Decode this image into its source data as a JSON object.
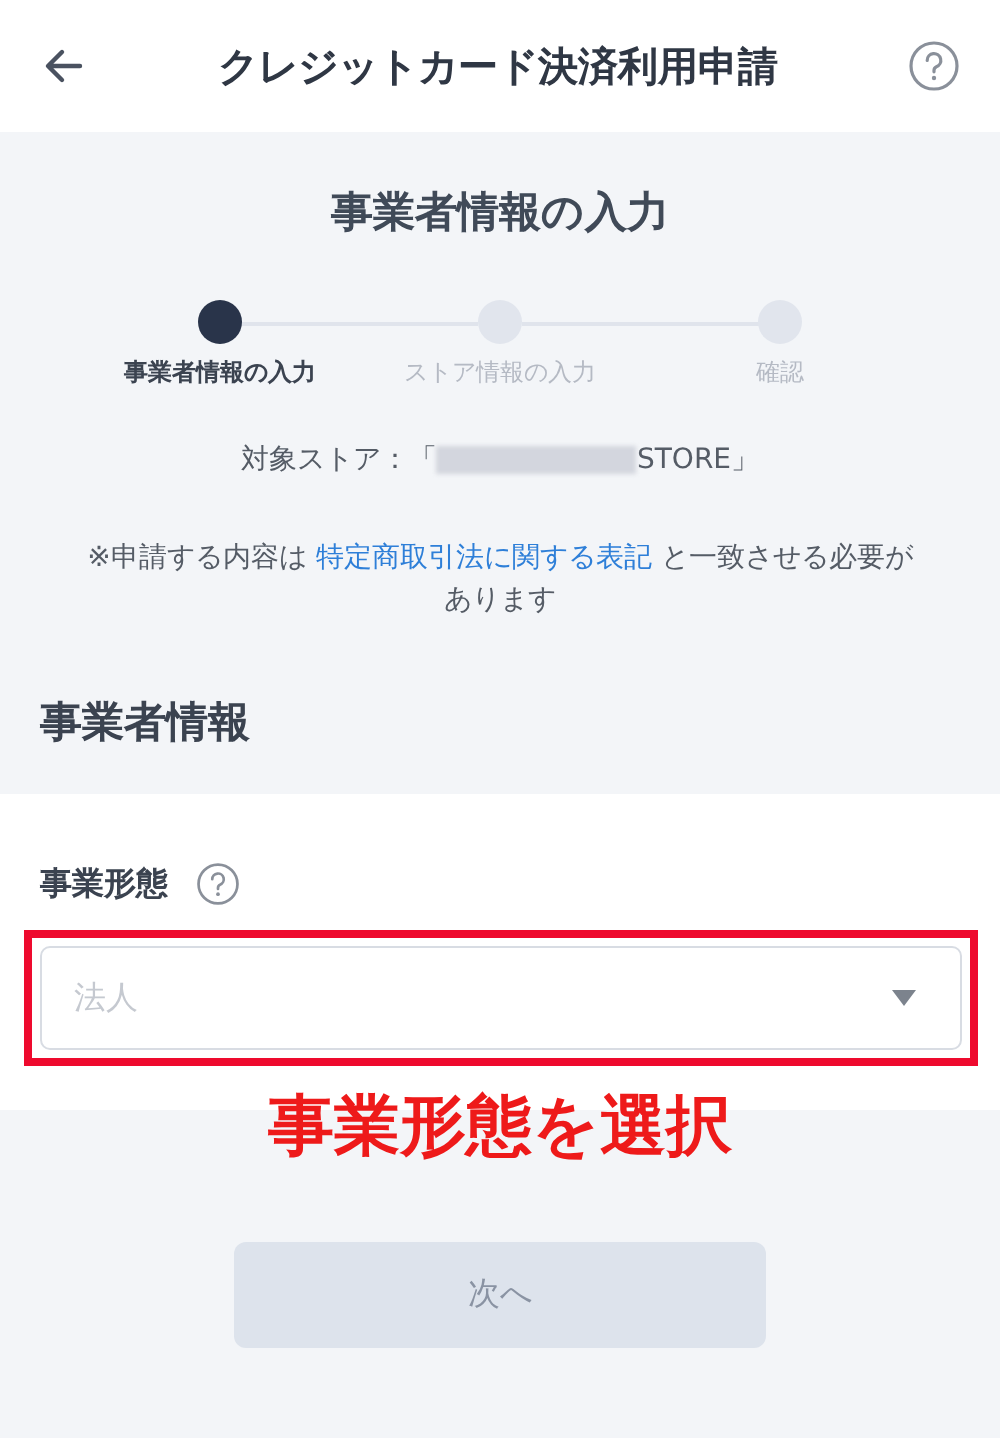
{
  "header": {
    "title": "クレジットカード決済利用申請"
  },
  "form_heading": "事業者情報の入力",
  "steps": [
    {
      "label": "事業者情報の入力",
      "selected": true
    },
    {
      "label": "ストア情報の入力",
      "selected": false
    },
    {
      "label": "確認",
      "selected": false
    }
  ],
  "store": {
    "prefix": "対象ストア：「",
    "suffix": "STORE」"
  },
  "notice": {
    "before": "※申請する内容は ",
    "link": "特定商取引法に関する表記",
    "after": " と一致させる必要があります"
  },
  "section_title": "事業者情報",
  "business_type": {
    "label": "事業形態",
    "placeholder": "法人"
  },
  "annotation": "事業形態を選択",
  "next_button": {
    "label": "次へ",
    "disabled": true
  }
}
